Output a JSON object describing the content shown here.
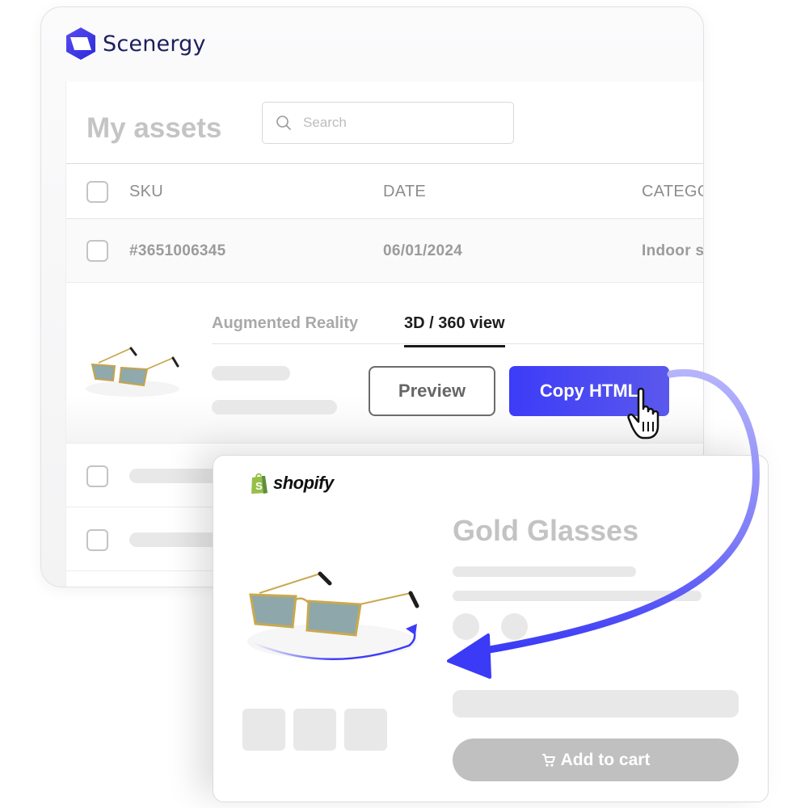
{
  "app": {
    "brand_name": "Scenergy",
    "page_title": "My assets",
    "search": {
      "placeholder": "Search",
      "value": ""
    },
    "table": {
      "columns": [
        "SKU",
        "DATE",
        "CATEGORY"
      ],
      "visible_column_labels": [
        "SKU",
        "DATE",
        "CATEGO"
      ],
      "rows": [
        {
          "sku": "#3651006345",
          "date": "06/01/2024",
          "category_visible": "Indoor s"
        }
      ]
    },
    "detail": {
      "tabs": [
        {
          "label": "Augmented Reality",
          "active": false
        },
        {
          "label": "3D / 360 view",
          "active": true
        }
      ],
      "preview_label": "Preview",
      "copy_html_label": "Copy HTML"
    }
  },
  "storefront": {
    "platform": "shopify",
    "product_title": "Gold Glasses",
    "add_to_cart_label": "Add to cart",
    "swatch_count": 2,
    "thumbnail_count": 3
  },
  "colors": {
    "accent": "#3d3cf8",
    "brand_text": "#1c1f5a",
    "shopify_green": "#95bf47",
    "skeleton": "#e8e8e8",
    "disabled_button": "#c0c0c0"
  },
  "icons": {
    "logo": "scenergy-hexagon-logo",
    "search": "search-icon",
    "cart": "cart-icon",
    "cursor": "hand-pointer-cursor",
    "flow": "curved-arrow"
  }
}
